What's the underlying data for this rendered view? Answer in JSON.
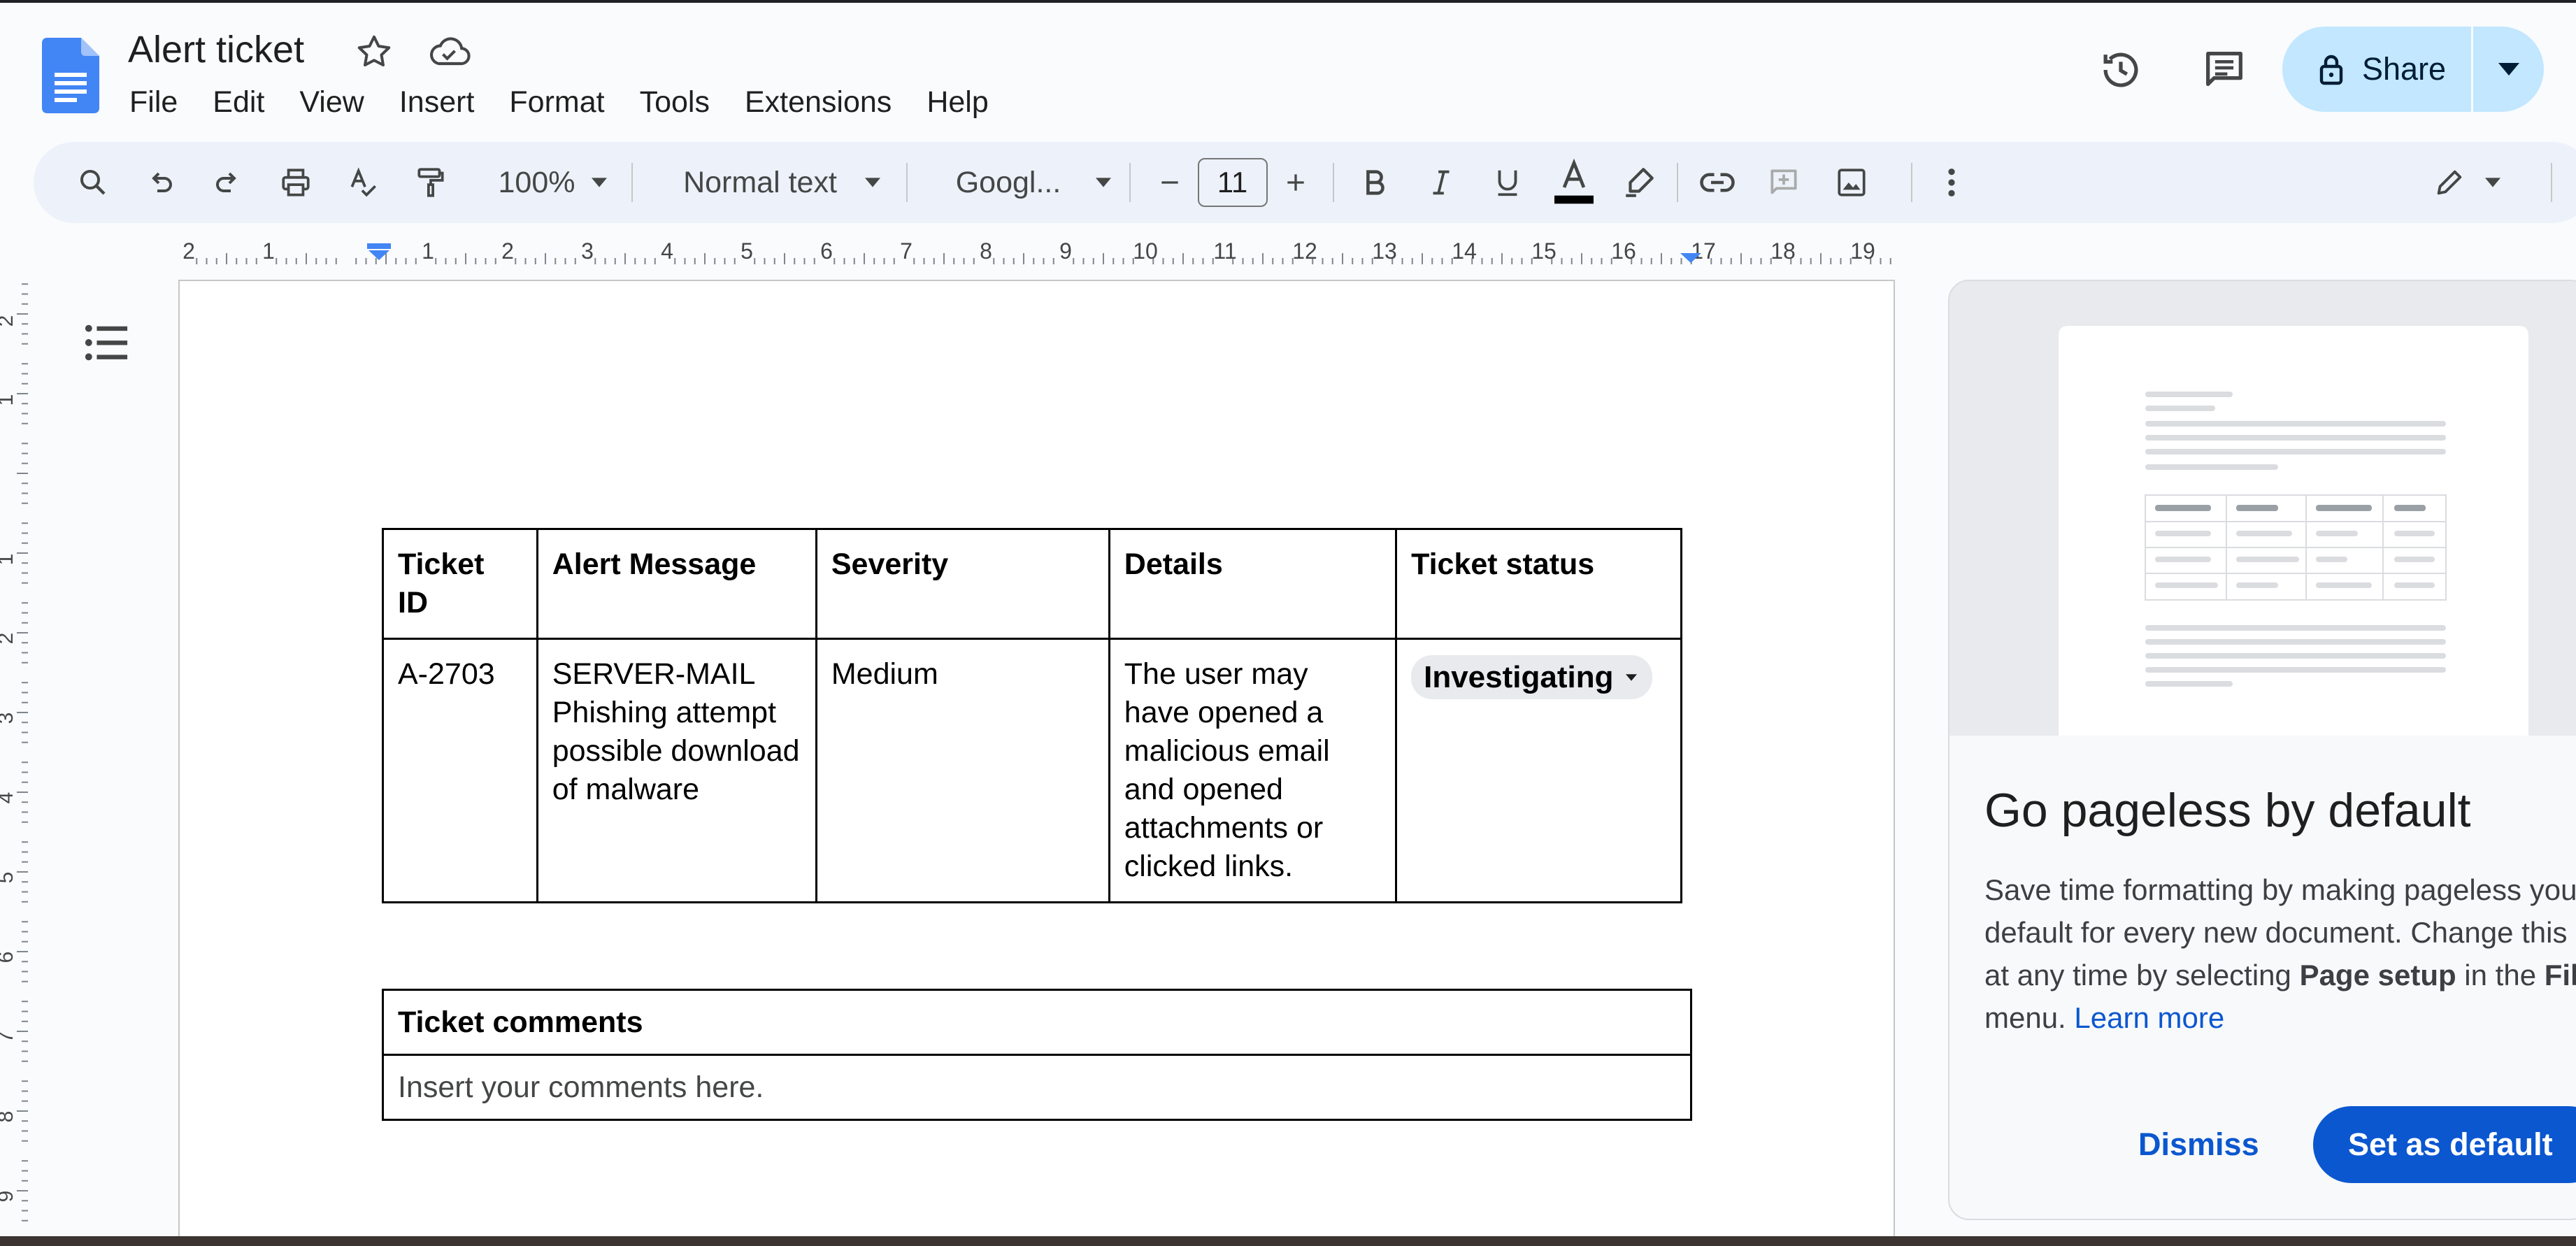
{
  "app": {
    "doc_title": "Alert ticket",
    "menu": [
      "File",
      "Edit",
      "View",
      "Insert",
      "Format",
      "Tools",
      "Extensions",
      "Help"
    ],
    "share_label": "Share"
  },
  "toolbar": {
    "zoom": "100%",
    "style": "Normal text",
    "font": "Googl...",
    "font_size": "11"
  },
  "ruler": {
    "h_ticks": [
      "2",
      "1",
      "1",
      "2",
      "3",
      "4",
      "5",
      "6",
      "7",
      "8",
      "9",
      "10",
      "11",
      "12",
      "13",
      "14",
      "15",
      "16",
      "17",
      "18",
      "19"
    ],
    "v_ticks": [
      "2",
      "1",
      "1",
      "2",
      "3",
      "4",
      "5",
      "6",
      "7",
      "8",
      "9"
    ]
  },
  "alert_table": {
    "headers": [
      "Ticket ID",
      "Alert Message",
      "Severity",
      "Details",
      "Ticket status"
    ],
    "row": {
      "ticket_id": "A-2703",
      "alert_message": "SERVER-MAIL Phishing attempt possible download of malware",
      "severity": "Medium",
      "details": "The user may have opened a malicious email and opened attachments or clicked links.",
      "status": "Investigating"
    }
  },
  "comments_table": {
    "header": "Ticket comments",
    "placeholder": "Insert your comments here."
  },
  "panel": {
    "title": "Go pageless by default",
    "body_1": "Save time formatting by making pageless your default for every new document. Change this at any time by selecting ",
    "body_bold_1": "Page setup",
    "body_2": " in the ",
    "body_bold_2": "File",
    "body_3": " menu. ",
    "learn_more": "Learn more",
    "dismiss": "Dismiss",
    "set_default": "Set as default"
  },
  "colors": {
    "accent": "#0b57d0",
    "share_bg": "#c2e7ff",
    "toolbar_bg": "#edf2fa",
    "docs_blue": "#4285f4"
  }
}
